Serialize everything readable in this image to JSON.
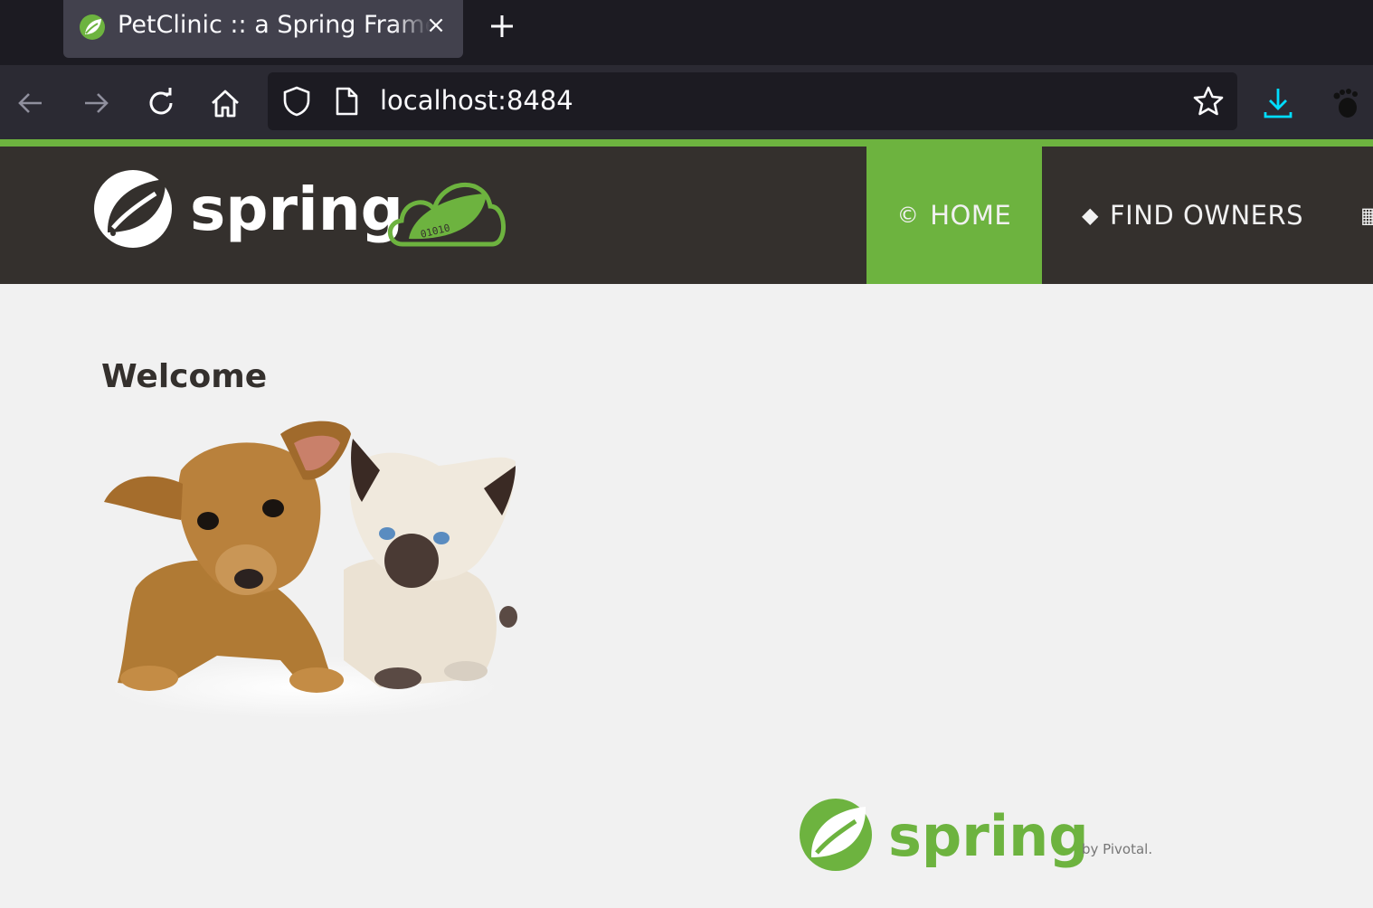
{
  "browser": {
    "tab": {
      "title": "PetClinic :: a Spring Framework demonstration",
      "close_icon": "close-icon"
    },
    "new_tab_icon": "plus-icon",
    "url": "localhost:8484",
    "icons": [
      "back-arrow-icon",
      "forward-arrow-icon",
      "reload-icon",
      "home-icon",
      "shield-icon",
      "page-icon",
      "star-icon",
      "download-icon",
      "gnome-foot-icon"
    ],
    "colors": {
      "tabbar": "#1c1b22",
      "toolbar": "#2b2a33",
      "tab": "#42414d",
      "download_accent": "#0df"
    }
  },
  "site": {
    "colors": {
      "brand_green": "#6db33f",
      "header": "#34302d",
      "background": "#f1f1f1"
    },
    "brand_text": "spring",
    "cloud_text": "01010",
    "menu": {
      "home": {
        "glyph": "©",
        "label": "HOME"
      },
      "find_owners": {
        "glyph": "◆",
        "label": "FIND OWNERS"
      },
      "next": {
        "glyph": "▦"
      }
    },
    "heading": "Welcome",
    "footer": {
      "logo_text": "spring",
      "byline": "by Pivotal."
    }
  }
}
